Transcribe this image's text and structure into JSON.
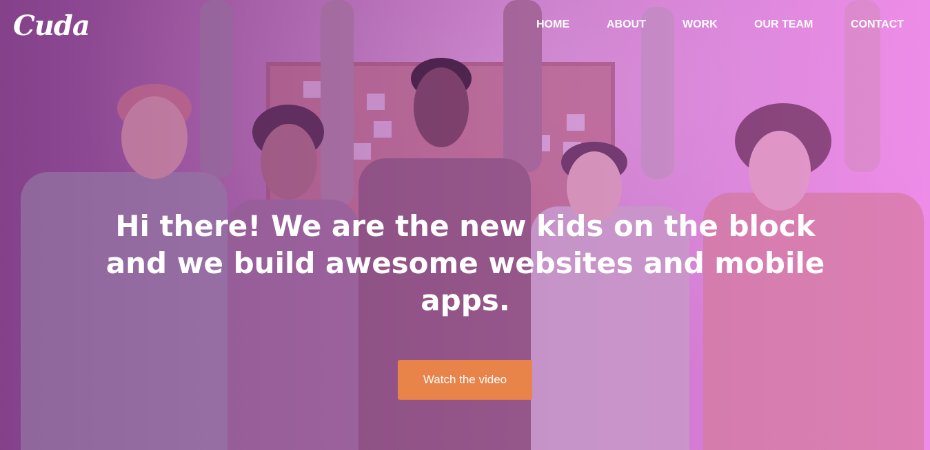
{
  "brand": {
    "logo_text": "Cuda"
  },
  "nav": {
    "items": [
      {
        "label": "HOME"
      },
      {
        "label": "ABOUT"
      },
      {
        "label": "WORK"
      },
      {
        "label": "OUR TEAM"
      },
      {
        "label": "CONTACT"
      }
    ]
  },
  "hero": {
    "headline": "Hi there! We are the new kids on the block and we build awesome websites and mobile apps.",
    "cta_label": "Watch the video",
    "background_image": "team-celebrating-photo"
  },
  "colors": {
    "overlay_left": "#8a4f8f",
    "overlay_right": "#ee99ea",
    "cta": "#e8834a",
    "text": "#ffffff"
  }
}
